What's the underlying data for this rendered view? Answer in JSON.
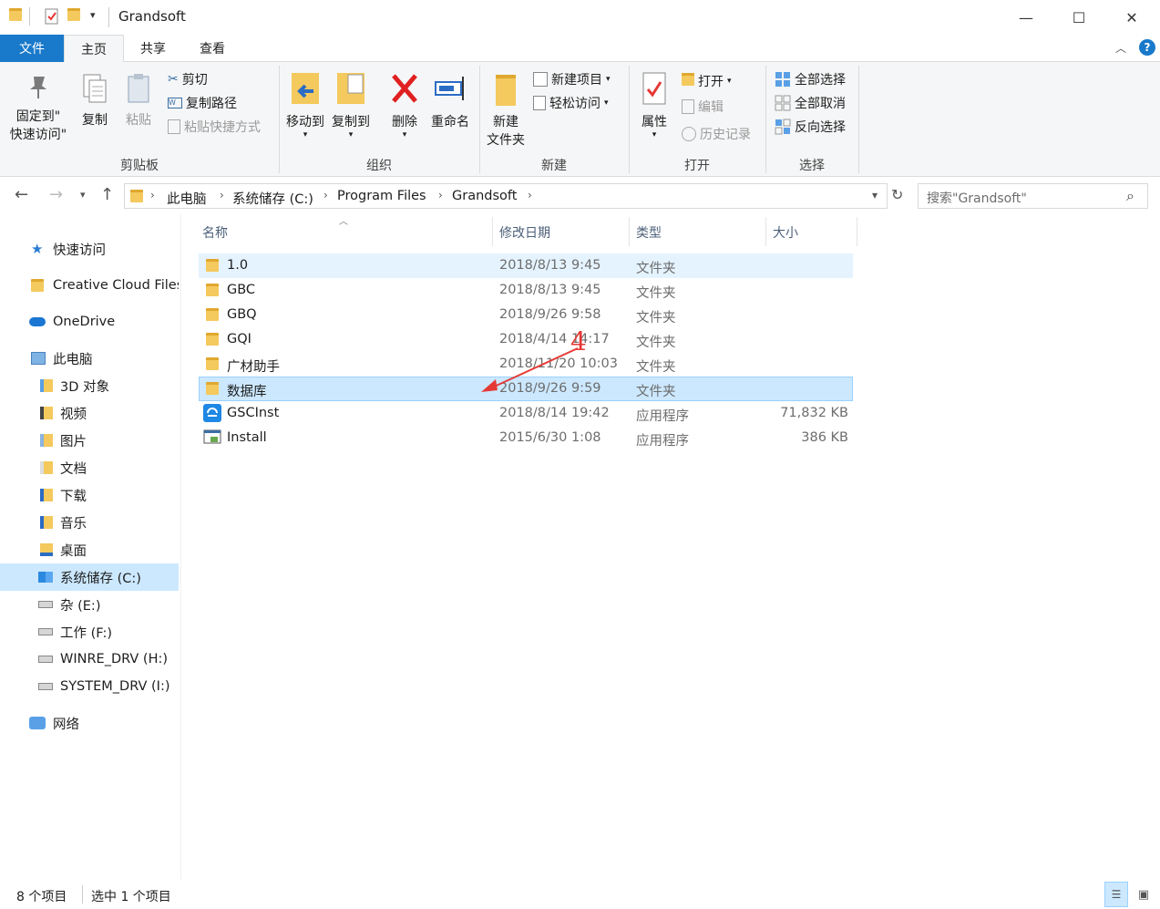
{
  "window": {
    "title": "Grandsoft",
    "minimize": "—",
    "maximize": "☐",
    "close": "✕"
  },
  "tabs": {
    "file": "文件",
    "home": "主页",
    "share": "共享",
    "view": "查看"
  },
  "ribbon": {
    "clipboard": {
      "group_label": "剪贴板",
      "pin_line1": "固定到\"",
      "pin_line2": "快速访问\"",
      "copy": "复制",
      "paste": "粘贴",
      "cut": "剪切",
      "copy_path": "复制路径",
      "paste_shortcut": "粘贴快捷方式"
    },
    "organize": {
      "group_label": "组织",
      "move_to": "移动到",
      "copy_to": "复制到",
      "delete": "删除",
      "rename": "重命名"
    },
    "new": {
      "group_label": "新建",
      "new_folder_line1": "新建",
      "new_folder_line2": "文件夹",
      "new_item": "新建项目",
      "easy_access": "轻松访问"
    },
    "open": {
      "group_label": "打开",
      "properties": "属性",
      "open": "打开",
      "edit": "编辑",
      "history": "历史记录"
    },
    "select": {
      "group_label": "选择",
      "select_all": "全部选择",
      "select_none": "全部取消",
      "invert": "反向选择"
    }
  },
  "address": {
    "crumbs": [
      "此电脑",
      "系统储存 (C:)",
      "Program Files",
      "Grandsoft"
    ],
    "search_placeholder": "搜索\"Grandsoft\""
  },
  "nav": {
    "items": [
      {
        "label": "快速访问"
      },
      {
        "label": "Creative Cloud Files"
      },
      {
        "label": "OneDrive"
      },
      {
        "label": "此电脑"
      },
      {
        "label": "3D 对象"
      },
      {
        "label": "视频"
      },
      {
        "label": "图片"
      },
      {
        "label": "文档"
      },
      {
        "label": "下载"
      },
      {
        "label": "音乐"
      },
      {
        "label": "桌面"
      },
      {
        "label": "系统储存 (C:)"
      },
      {
        "label": "杂 (E:)"
      },
      {
        "label": "工作 (F:)"
      },
      {
        "label": "WINRE_DRV (H:)"
      },
      {
        "label": "SYSTEM_DRV (I:)"
      },
      {
        "label": "网络"
      }
    ]
  },
  "columns": {
    "name": "名称",
    "modified": "修改日期",
    "type": "类型",
    "size": "大小"
  },
  "files": [
    {
      "name": "1.0",
      "modified": "2018/8/13 9:45",
      "type": "文件夹",
      "size": ""
    },
    {
      "name": "GBC",
      "modified": "2018/8/13 9:45",
      "type": "文件夹",
      "size": ""
    },
    {
      "name": "GBQ",
      "modified": "2018/9/26 9:58",
      "type": "文件夹",
      "size": ""
    },
    {
      "name": "GQI",
      "modified": "2018/4/14 14:17",
      "type": "文件夹",
      "size": ""
    },
    {
      "name": "广材助手",
      "modified": "2018/11/20 10:03",
      "type": "文件夹",
      "size": ""
    },
    {
      "name": "数据库",
      "modified": "2018/9/26 9:59",
      "type": "文件夹",
      "size": ""
    },
    {
      "name": "GSCInst",
      "modified": "2018/8/14 19:42",
      "type": "应用程序",
      "size": "71,832 KB"
    },
    {
      "name": "Install",
      "modified": "2015/6/30 1:08",
      "type": "应用程序",
      "size": "386 KB"
    }
  ],
  "annotation": {
    "label": "4",
    "color": "#e53935"
  },
  "status": {
    "count": "8 个项目",
    "selected": "选中 1 个项目"
  },
  "colors": {
    "accent": "#1979ca",
    "selection": "#cce8ff",
    "folder": "#f4c95d"
  }
}
